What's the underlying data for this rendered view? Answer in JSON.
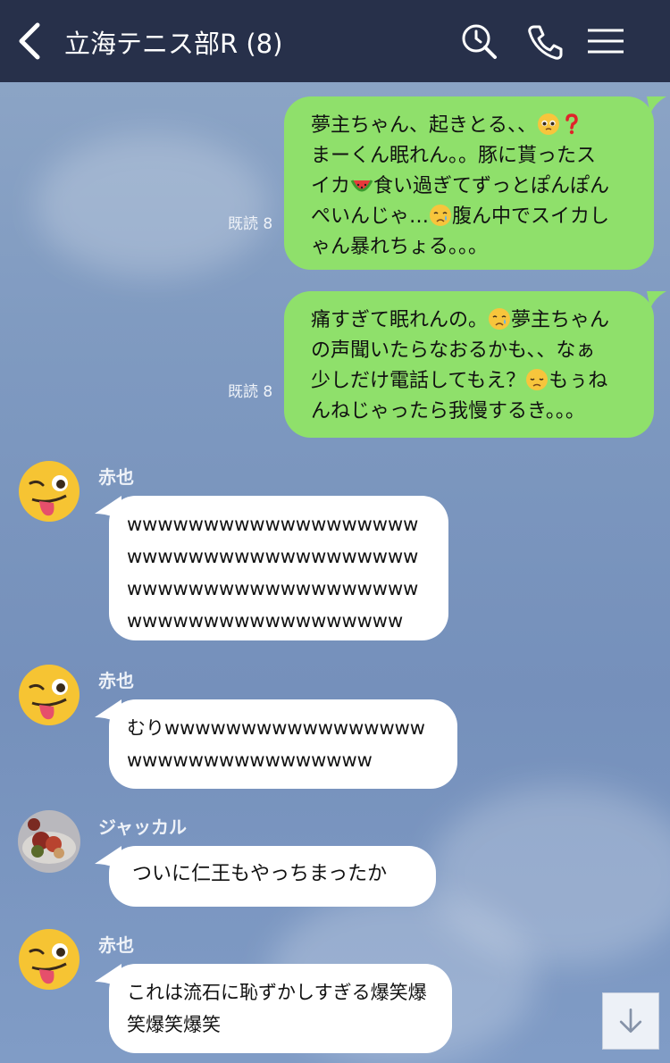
{
  "header": {
    "title": "立海テニス部R (8)"
  },
  "messages_out": [
    {
      "text": "夢主ちゃん、起きとる、、🥺❓まーくん眠れん。。豚に貰ったスイカ🍉食い過ぎてずっとぽんぽんぺいんじゃ…😢腹ん中でスイカしゃん暴れちょる。。。",
      "lines": [
        "夢主ちゃん、起きとる、、",
        "まーくん眠れん。。豚に貰ったス",
        "イカ",
        "食い過ぎてずっとぽんぽん",
        "ぺいんじゃ…",
        "腹ん中でスイカし",
        "ゃん暴れちょる。。。"
      ],
      "read": "既読 8"
    },
    {
      "lines": [
        "痛すぎて眠れんの。",
        "夢主ちゃん",
        "の声聞いたらなおるかも、、なぁ",
        "少しだけ電話してもえ？",
        "もぅね",
        "んねじゃったら我慢するき。。。"
      ],
      "read": "既読 8"
    }
  ],
  "messages_in": [
    {
      "sender": "赤也",
      "text": "wwwwwwwwwwwwwwwwwwwwwwwwwwwwwwwwwwwwwwwwwwwwwwwwwwwwwwwwwwwwwwwwwwwwwwwwwww"
    },
    {
      "sender": "赤也",
      "text": "むりwwwwwwwwwwwwwwwwwwwwwwwwwwwwwwwww"
    },
    {
      "sender": "ジャッカル",
      "text": "ついに仁王もやっちまったか"
    },
    {
      "sender": "赤也",
      "text": "これは流石に恥ずかしすぎる爆笑爆笑爆笑爆笑"
    }
  ],
  "icons": {
    "back": "chevron-left-icon",
    "search": "search-icon",
    "call": "phone-icon",
    "menu": "menu-icon",
    "scroll": "arrow-down-icon"
  },
  "colors": {
    "header": "#27304a",
    "outgoing_bubble": "#8fe06b",
    "incoming_bubble": "#ffffff"
  }
}
